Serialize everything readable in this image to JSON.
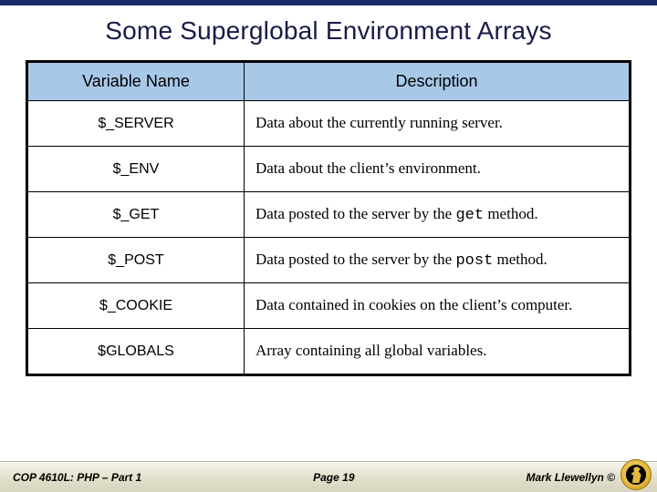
{
  "title": "Some Superglobal Environment Arrays",
  "headers": {
    "col1": "Variable Name",
    "col2": "Description"
  },
  "rows": [
    {
      "var": "$_SERVER",
      "desc_pre": "Data about the currently running server.",
      "mono": "",
      "desc_post": ""
    },
    {
      "var": "$_ENV",
      "desc_pre": "Data about the client’s environment.",
      "mono": "",
      "desc_post": ""
    },
    {
      "var": "$_GET",
      "desc_pre": "Data posted to the server by the ",
      "mono": "get",
      "desc_post": " method."
    },
    {
      "var": "$_POST",
      "desc_pre": "Data posted to the server by the ",
      "mono": "post",
      "desc_post": " method."
    },
    {
      "var": "$_COOKIE",
      "desc_pre": "Data contained in cookies on the client’s computer.",
      "mono": "",
      "desc_post": ""
    },
    {
      "var": "$GLOBALS",
      "desc_pre": "Array containing all global variables.",
      "mono": "",
      "desc_post": ""
    }
  ],
  "footer": {
    "left": "COP 4610L: PHP – Part 1",
    "center": "Page 19",
    "right": "Mark Llewellyn ©"
  }
}
